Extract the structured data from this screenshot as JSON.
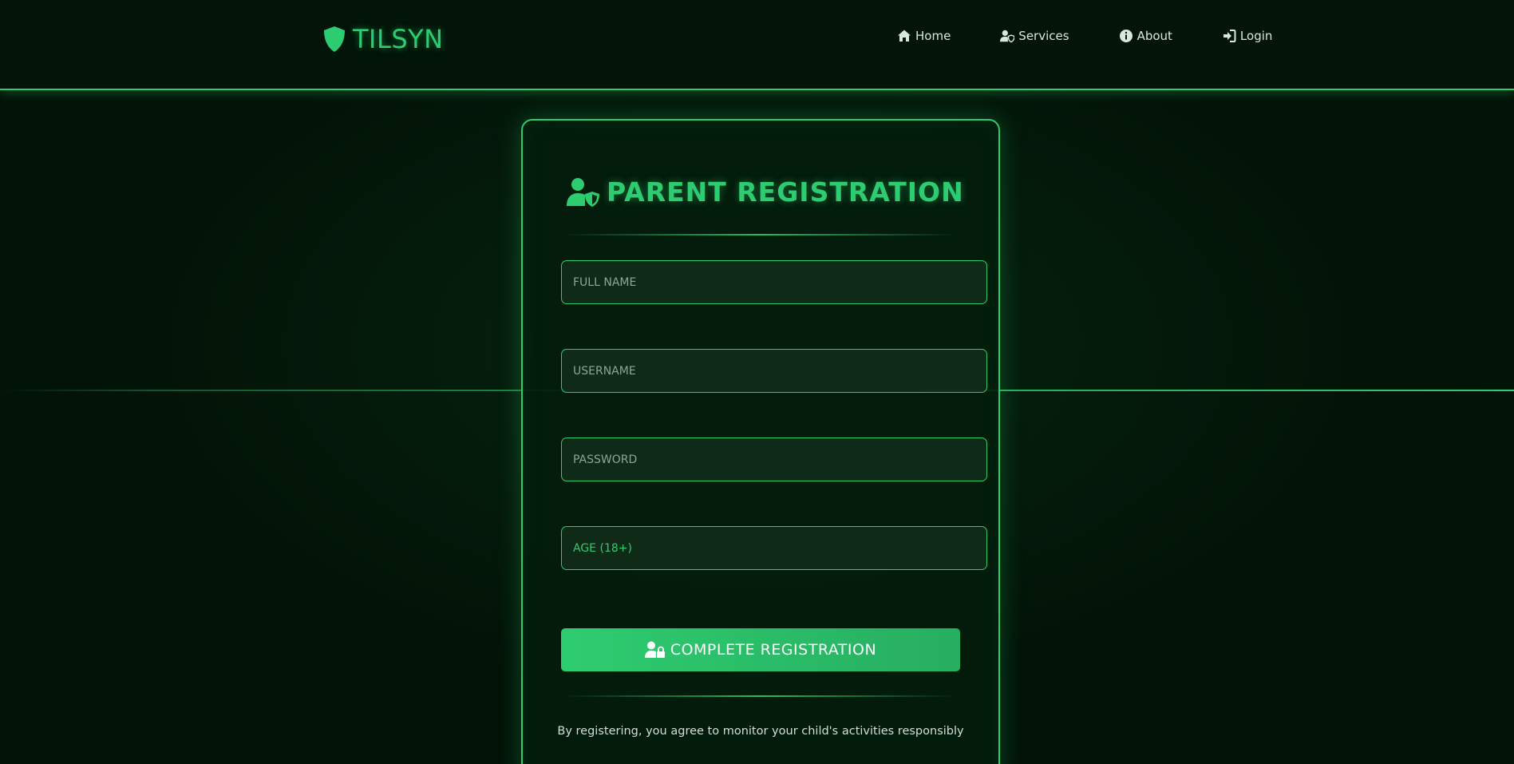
{
  "app": {
    "logo_text": "TILSYN"
  },
  "nav": {
    "items": [
      {
        "label": "Home",
        "icon": "home-icon"
      },
      {
        "label": "Services",
        "icon": "user-shield-icon"
      },
      {
        "label": "About",
        "icon": "info-circle-icon"
      },
      {
        "label": "Login",
        "icon": "sign-in-icon"
      }
    ]
  },
  "form": {
    "title": "PARENT REGISTRATION",
    "title_icon": "user-shield-icon",
    "fields": [
      {
        "placeholder": "FULL NAME",
        "value": ""
      },
      {
        "placeholder": "USERNAME",
        "value": ""
      },
      {
        "placeholder": "PASSWORD",
        "value": ""
      },
      {
        "placeholder": "AGE (18+)",
        "value": ""
      }
    ],
    "submit_label": "COMPLETE REGISTRATION",
    "submit_icon": "user-lock-icon",
    "note": "By registering, you agree to monitor your child's activities responsibly"
  },
  "colors": {
    "accent": "#2ecc71",
    "accent_dark": "#27ae60",
    "background": "#021307",
    "text_light": "#d9e8dd"
  }
}
